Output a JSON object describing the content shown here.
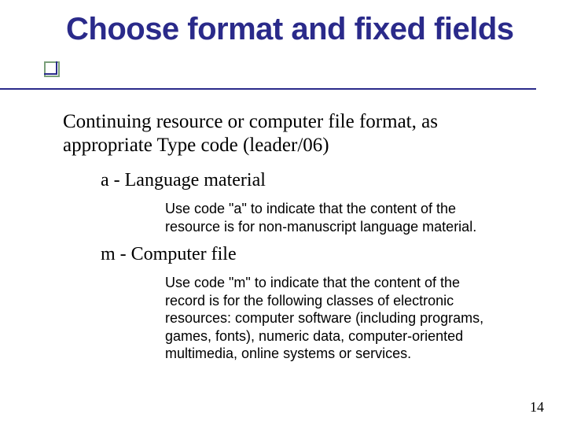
{
  "title": "Choose format and fixed fields",
  "intro": "Continuing resource or computer file format, as appropriate Type code (leader/06)",
  "items": [
    {
      "heading": "a - Language material",
      "description": "Use code \"a\" to indicate that the content of the resource is for non-manuscript language material."
    },
    {
      "heading": "m - Computer file",
      "description": "Use code \"m\" to indicate that the content of the record is for the following classes of electronic resources:  computer software (including programs, games, fonts), numeric data, computer-oriented multimedia, online systems or services."
    }
  ],
  "page_number": "14"
}
